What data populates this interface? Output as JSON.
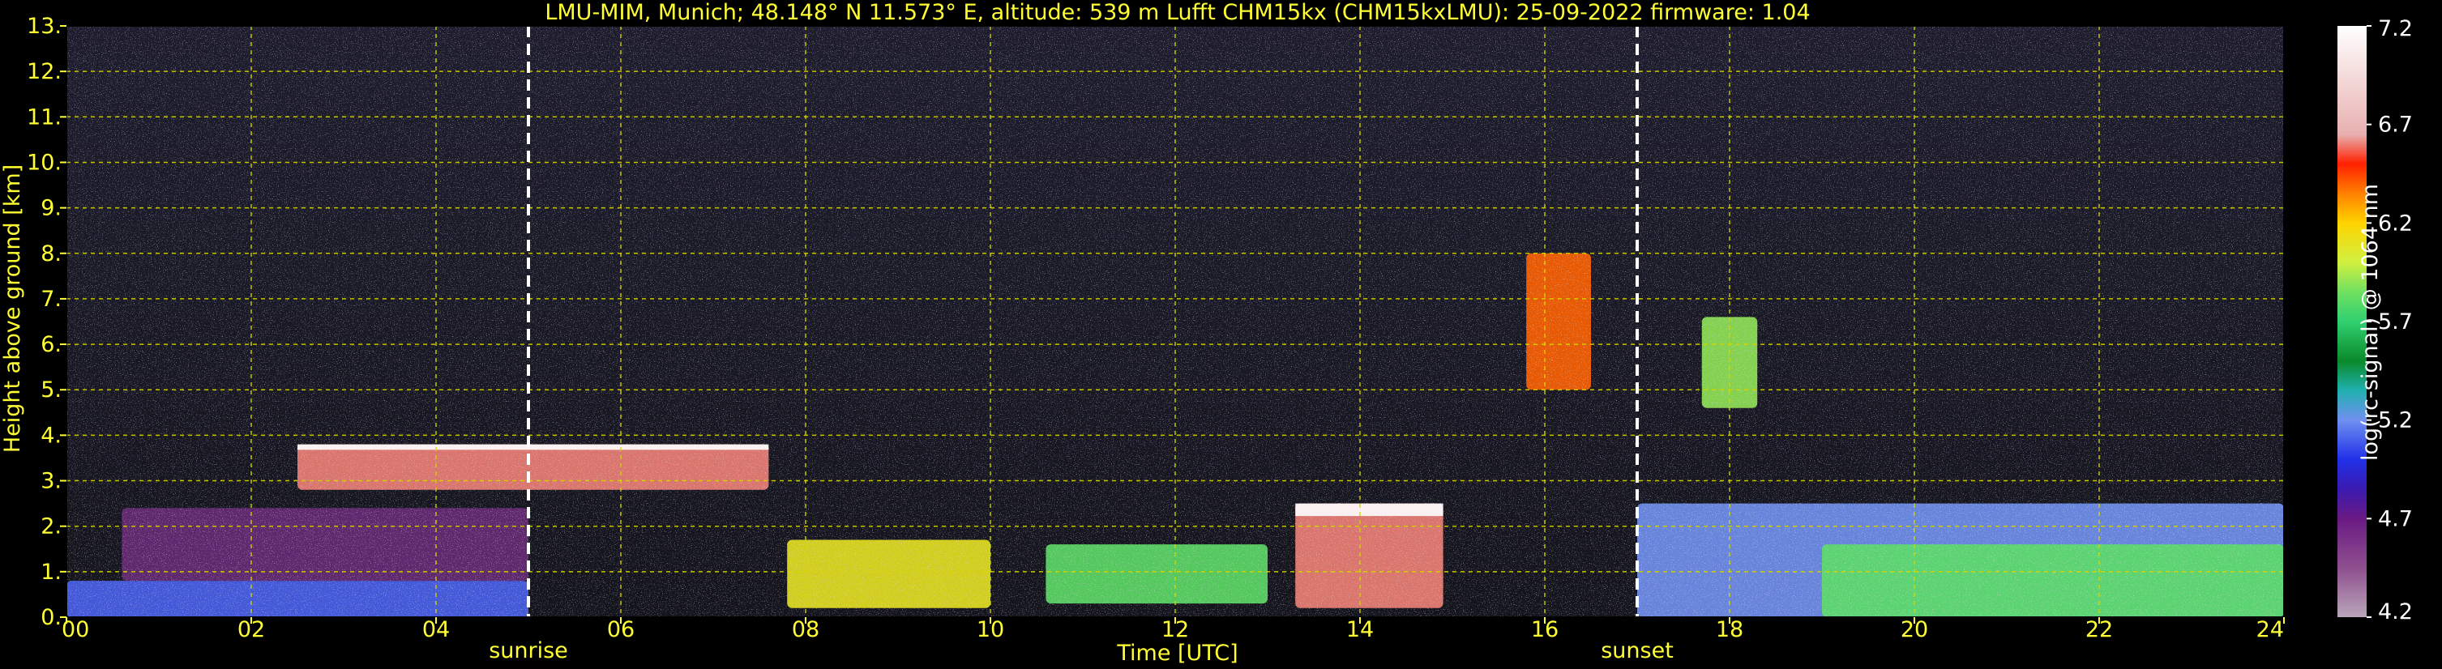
{
  "chart_data": {
    "type": "heatmap",
    "title": "LMU-MIM, Munich; 48.148° N 11.573° E, altitude: 539 m    Lufft CHM15kx (CHM15kxLMU): 25-09-2022    firmware: 1.04",
    "xlabel": "Time [UTC]",
    "ylabel": "Height above ground [km]",
    "colorbar_label": "log(rc-signal) @ 1064 nm",
    "xlim": [
      0,
      24
    ],
    "ylim": [
      0,
      13
    ],
    "x_ticks": [
      0,
      2,
      4,
      6,
      8,
      10,
      12,
      14,
      16,
      18,
      20,
      22,
      24
    ],
    "x_tick_labels": [
      "00",
      "02",
      "04",
      "06",
      "08",
      "10",
      "12",
      "14",
      "16",
      "18",
      "20",
      "22",
      "24"
    ],
    "y_ticks": [
      0,
      1,
      2,
      3,
      4,
      5,
      6,
      7,
      8,
      9,
      10,
      11,
      12,
      13
    ],
    "y_tick_labels": [
      "0.",
      "1.",
      "2.",
      "3.",
      "4.",
      "5.",
      "6.",
      "7.",
      "8.",
      "9.",
      "10.",
      "11.",
      "12.",
      "13."
    ],
    "grid": true,
    "colorbar": {
      "range": [
        4.2,
        7.2
      ],
      "ticks": [
        4.2,
        4.7,
        5.2,
        5.7,
        6.2,
        6.7,
        7.2
      ],
      "tick_labels": [
        "4.2",
        "4.7",
        "5.2",
        "5.7",
        "6.2",
        "6.7",
        "7.2"
      ],
      "stops": [
        [
          4.2,
          "#b9a6b9"
        ],
        [
          4.45,
          "#8e4f8e"
        ],
        [
          4.7,
          "#6a1a84"
        ],
        [
          4.85,
          "#3a1ab0"
        ],
        [
          5.0,
          "#2030e8"
        ],
        [
          5.2,
          "#7090f0"
        ],
        [
          5.35,
          "#20b0b0"
        ],
        [
          5.5,
          "#0a8a2a"
        ],
        [
          5.7,
          "#30d070"
        ],
        [
          5.85,
          "#70e060"
        ],
        [
          6.0,
          "#d0f040"
        ],
        [
          6.2,
          "#ffd400"
        ],
        [
          6.35,
          "#ff8000"
        ],
        [
          6.5,
          "#ff2000"
        ],
        [
          6.65,
          "#e8b0b0"
        ],
        [
          7.2,
          "#ffffff"
        ]
      ]
    },
    "markers": [
      {
        "time": 5.0,
        "label": "sunrise"
      },
      {
        "time": 17.0,
        "label": "sunset"
      }
    ],
    "features": [
      {
        "kind": "boundary_layer",
        "t0": 0.0,
        "t1": 5.0,
        "h0": 0.0,
        "h1": 0.8,
        "value": 5.1
      },
      {
        "kind": "residual_layer",
        "t0": 0.6,
        "t1": 5.0,
        "h0": 0.8,
        "h1": 2.4,
        "value": 4.6
      },
      {
        "kind": "aerosol_layer",
        "t0": 7.8,
        "t1": 10.0,
        "h0": 0.2,
        "h1": 1.7,
        "value": 6.1
      },
      {
        "kind": "aerosol_layer",
        "t0": 10.6,
        "t1": 13.0,
        "h0": 0.3,
        "h1": 1.6,
        "value": 5.8
      },
      {
        "kind": "cloud",
        "t0": 13.3,
        "t1": 14.9,
        "h0": 0.2,
        "h1": 2.5,
        "value": 6.6
      },
      {
        "kind": "elevated_layer",
        "t0": 2.5,
        "t1": 7.6,
        "h0": 2.8,
        "h1": 3.8,
        "value": 6.6
      },
      {
        "kind": "cirrus",
        "t0": 15.8,
        "t1": 16.5,
        "h0": 5.0,
        "h1": 8.0,
        "value": 6.4
      },
      {
        "kind": "cirrus",
        "t0": 17.7,
        "t1": 18.3,
        "h0": 4.6,
        "h1": 6.6,
        "value": 5.9
      },
      {
        "kind": "boundary_layer",
        "t0": 17.0,
        "t1": 24.0,
        "h0": 0.0,
        "h1": 2.5,
        "value": 5.2
      },
      {
        "kind": "aerosol_layer",
        "t0": 19.0,
        "t1": 24.0,
        "h0": 0.0,
        "h1": 1.6,
        "value": 5.8
      }
    ]
  }
}
